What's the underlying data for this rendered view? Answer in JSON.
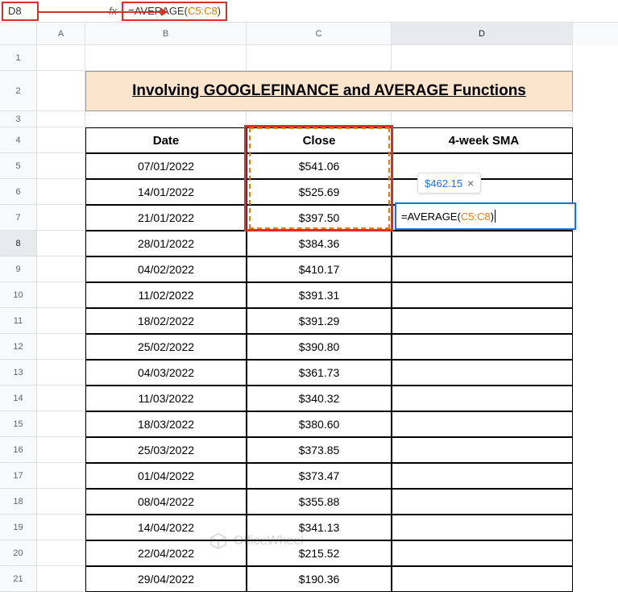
{
  "active_cell": "D8",
  "formula": {
    "prefix": "=AVERAGE(",
    "range": "C5:C8",
    "suffix": ")"
  },
  "columns": [
    "A",
    "B",
    "C",
    "D"
  ],
  "row_numbers": [
    "1",
    "2",
    "3",
    "4",
    "5",
    "6",
    "7",
    "8",
    "9",
    "10",
    "11",
    "12",
    "13",
    "14",
    "15",
    "16",
    "17",
    "18",
    "19",
    "20",
    "21"
  ],
  "title": "Involving GOOGLEFINANCE and AVERAGE Functions",
  "headers": {
    "date": "Date",
    "close": "Close",
    "sma": "4-week SMA"
  },
  "tooltip": {
    "value": "$462.15",
    "close": "×"
  },
  "cell_formula": {
    "prefix": "=AVERAGE(",
    "range": "C5:C8",
    "suffix": ")"
  },
  "rows": [
    {
      "date": "07/01/2022",
      "close": "$541.06"
    },
    {
      "date": "14/01/2022",
      "close": "$525.69"
    },
    {
      "date": "21/01/2022",
      "close": "$397.50"
    },
    {
      "date": "28/01/2022",
      "close": "$384.36"
    },
    {
      "date": "04/02/2022",
      "close": "$410.17"
    },
    {
      "date": "11/02/2022",
      "close": "$391.31"
    },
    {
      "date": "18/02/2022",
      "close": "$391.29"
    },
    {
      "date": "25/02/2022",
      "close": "$390.80"
    },
    {
      "date": "04/03/2022",
      "close": "$361.73"
    },
    {
      "date": "11/03/2022",
      "close": "$340.32"
    },
    {
      "date": "18/03/2022",
      "close": "$380.60"
    },
    {
      "date": "25/03/2022",
      "close": "$373.85"
    },
    {
      "date": "01/04/2022",
      "close": "$373.47"
    },
    {
      "date": "08/04/2022",
      "close": "$355.88"
    },
    {
      "date": "14/04/2022",
      "close": "$341.13"
    },
    {
      "date": "22/04/2022",
      "close": "$215.52"
    },
    {
      "date": "29/04/2022",
      "close": "$190.36"
    }
  ],
  "watermark": "OfficeWheel"
}
